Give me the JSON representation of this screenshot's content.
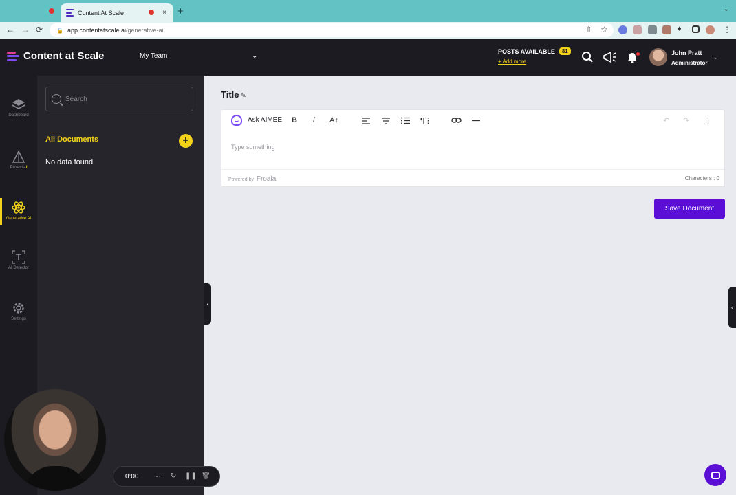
{
  "browser": {
    "tab_title": "Content At Scale",
    "tab_close": "×",
    "new_tab": "+",
    "tab_menu": "⌄",
    "url_host": "app.contentatscale.ai",
    "url_path": "/generative-ai",
    "back": "←",
    "forward": "→",
    "reload": "⟳",
    "share": "⇧",
    "bookmark": "☆",
    "menu": "⋮"
  },
  "app": {
    "logo_text": "Content at Scale",
    "team_selector": "My Team",
    "team_chevron": "⌄",
    "posts_available_label": "POSTS AVAILABLE",
    "posts_available_count": "81",
    "add_more": "+ Add more",
    "user_name": "John Pratt",
    "user_role": "Administrator",
    "user_chevron": "⌄"
  },
  "nav": {
    "items": [
      {
        "label": "Dashboard",
        "icon": "layers-icon"
      },
      {
        "label": "Projects",
        "icon": "triangle-icon",
        "badge": "i"
      },
      {
        "label": "Generative AI",
        "icon": "atom-icon",
        "active": true
      },
      {
        "label": "AI Detector",
        "icon": "text-scan-icon"
      },
      {
        "label": "Settings",
        "icon": "gear-icon"
      }
    ]
  },
  "docs": {
    "search_placeholder": "Search",
    "all_documents": "All Documents",
    "add": "+",
    "empty": "No data found"
  },
  "editor": {
    "title": "Title",
    "ask_aimee": "Ask AIMEE",
    "bold": "B",
    "italic": "i",
    "font_size": "A↕",
    "placeholder": "Type something",
    "powered_by": "Powered by",
    "powered_brand": "Froala",
    "characters": "Characters : 0",
    "save_button": "Save Document"
  },
  "recorder": {
    "time": "0:00"
  },
  "colors": {
    "accent_yellow": "#f3d21a",
    "accent_purple": "#5b0ed6",
    "dark_bg": "#1c1b22",
    "panel_bg": "#26252c",
    "browser_teal": "#62c2c4"
  }
}
